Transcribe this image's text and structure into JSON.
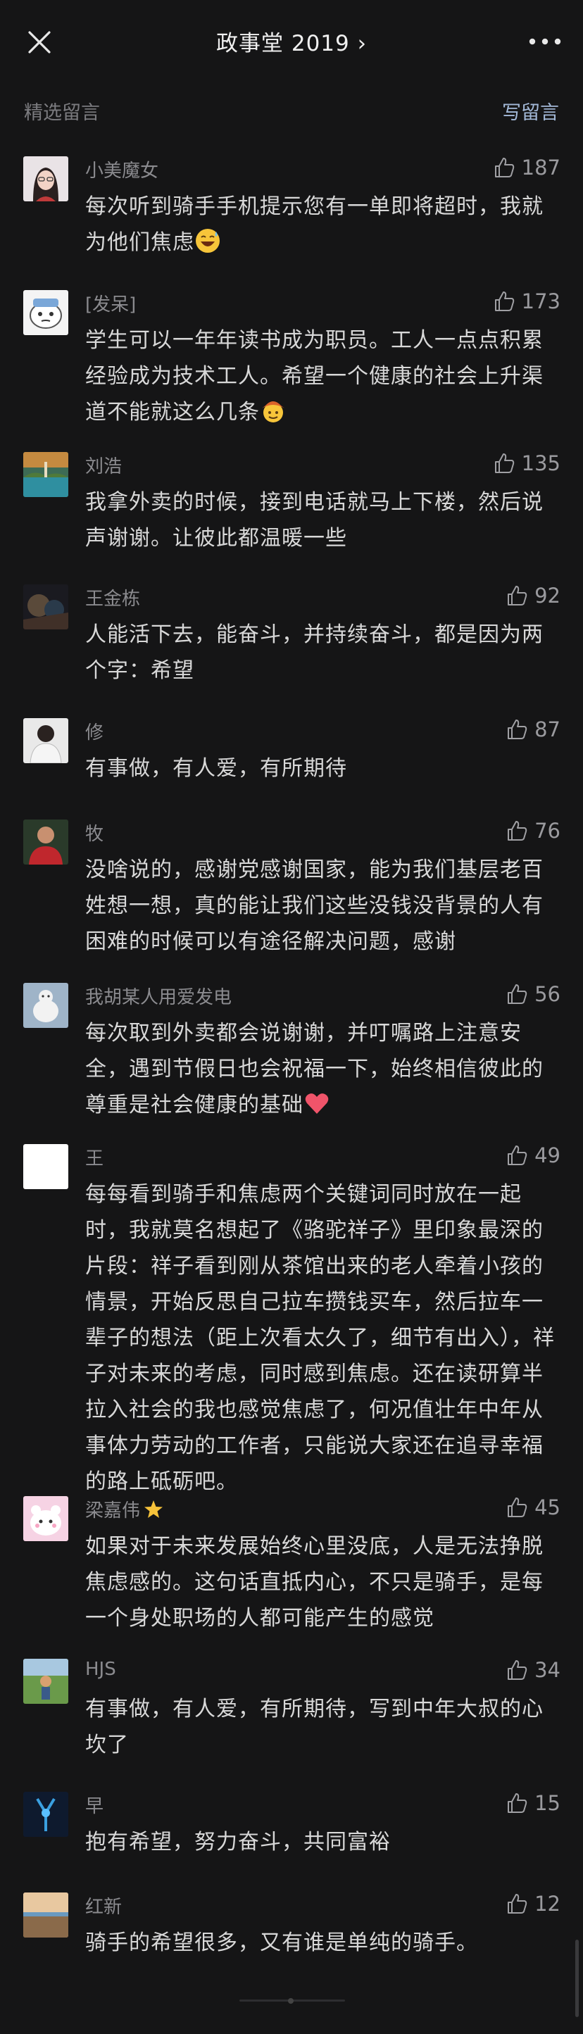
{
  "header": {
    "title": "政事堂 2019 ›"
  },
  "section": {
    "label": "精选留言",
    "write_label": "写留言"
  },
  "comments": [
    {
      "name": "小美魔女",
      "likes": "187",
      "text": "每次听到骑手手机提示您有一单即将超时，我就为他们焦虑",
      "emoji": "grinning-sweat-emoji"
    },
    {
      "name": "[发呆]",
      "likes": "173",
      "text": "学生可以一年年读书成为职员。工人一点点积累经验成为技术工人。希望一个健康的社会上升渠道不能就这么几条",
      "emoji": "cowboy-face-emoji"
    },
    {
      "name": "刘浩",
      "likes": "135",
      "text": "我拿外卖的时候，接到电话就马上下楼，然后说声谢谢。让彼此都温暖一些"
    },
    {
      "name": "王金栋",
      "likes": "92",
      "text": "人能活下去，能奋斗，并持续奋斗，都是因为两个字：希望"
    },
    {
      "name": "修",
      "likes": "87",
      "text": "有事做，有人爱，有所期待"
    },
    {
      "name": "牧",
      "likes": "76",
      "text": "没啥说的，感谢党感谢国家，能为我们基层老百姓想一想，真的能让我们这些没钱没背景的人有困难的时候可以有途径解决问题，感谢"
    },
    {
      "name": "我胡某人用爱发电",
      "likes": "56",
      "text": "每次取到外卖都会说谢谢，并叮嘱路上注意安全，遇到节假日也会祝福一下，始终相信彼此的尊重是社会健康的基础",
      "emoji": "heart-emoji"
    },
    {
      "name": "王",
      "likes": "49",
      "text": "每每看到骑手和焦虑两个关键词同时放在一起时，我就莫名想起了《骆驼祥子》里印象最深的片段：祥子看到刚从茶馆出来的老人牵着小孩的情景，开始反思自己拉车攒钱买车，然后拉车一辈子的想法（距上次看太久了，细节有出入），祥子对未来的考虑，同时感到焦虑。还在读研算半拉入社会的我也感觉焦虑了，何况值壮年中年从事体力劳动的工作者，只能说大家还在追寻幸福的路上砥砺吧。"
    },
    {
      "name": "梁嘉伟",
      "likes": "45",
      "text": "如果对于未来发展始终心里没底，人是无法挣脱焦虑感的。这句话直抵内心，不只是骑手，是每一个身处职场的人都可能产生的感觉",
      "name_emoji": "star-emoji"
    },
    {
      "name": "HJS",
      "likes": "34",
      "text": "有事做，有人爱，有所期待，写到中年大叔的心坎了"
    },
    {
      "name": "早",
      "likes": "15",
      "text": "抱有希望，努力奋斗，共同富裕"
    },
    {
      "name": "红新",
      "likes": "12",
      "text": "骑手的希望很多，又有谁是单纯的骑手。"
    }
  ]
}
